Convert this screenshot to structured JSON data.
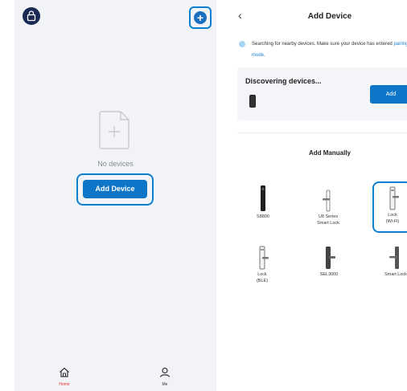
{
  "left": {
    "empty_text": "No devices",
    "add_button": "Add Device",
    "tabs": [
      {
        "label": "Home",
        "color": "#e53935"
      },
      {
        "label": "Me",
        "color": "#333333"
      }
    ]
  },
  "right": {
    "title": "Add Device",
    "search_msg_prefix": "Searching for nearby devices. Make sure your device has entered ",
    "search_msg_link": "pairing mode",
    "search_msg_suffix": ".",
    "discovering_title": "Discovering devices...",
    "discover_add_label": "Add",
    "manual_title": "Add Manually",
    "devices": [
      {
        "label_1": "S8800",
        "label_2": ""
      },
      {
        "label_1": "U8 Series",
        "label_2": "Smart Lock"
      },
      {
        "label_1": "Lock",
        "label_2": "(Wi-Fi)"
      },
      {
        "label_1": "Lock",
        "label_2": "(BLE)"
      },
      {
        "label_1": "SEL3000",
        "label_2": ""
      },
      {
        "label_1": "Smart Lock",
        "label_2": ""
      }
    ]
  },
  "colors": {
    "accent": "#0d76c8",
    "highlight_outline": "#0d7ed0",
    "panel_bg": "#f2f3f6"
  }
}
